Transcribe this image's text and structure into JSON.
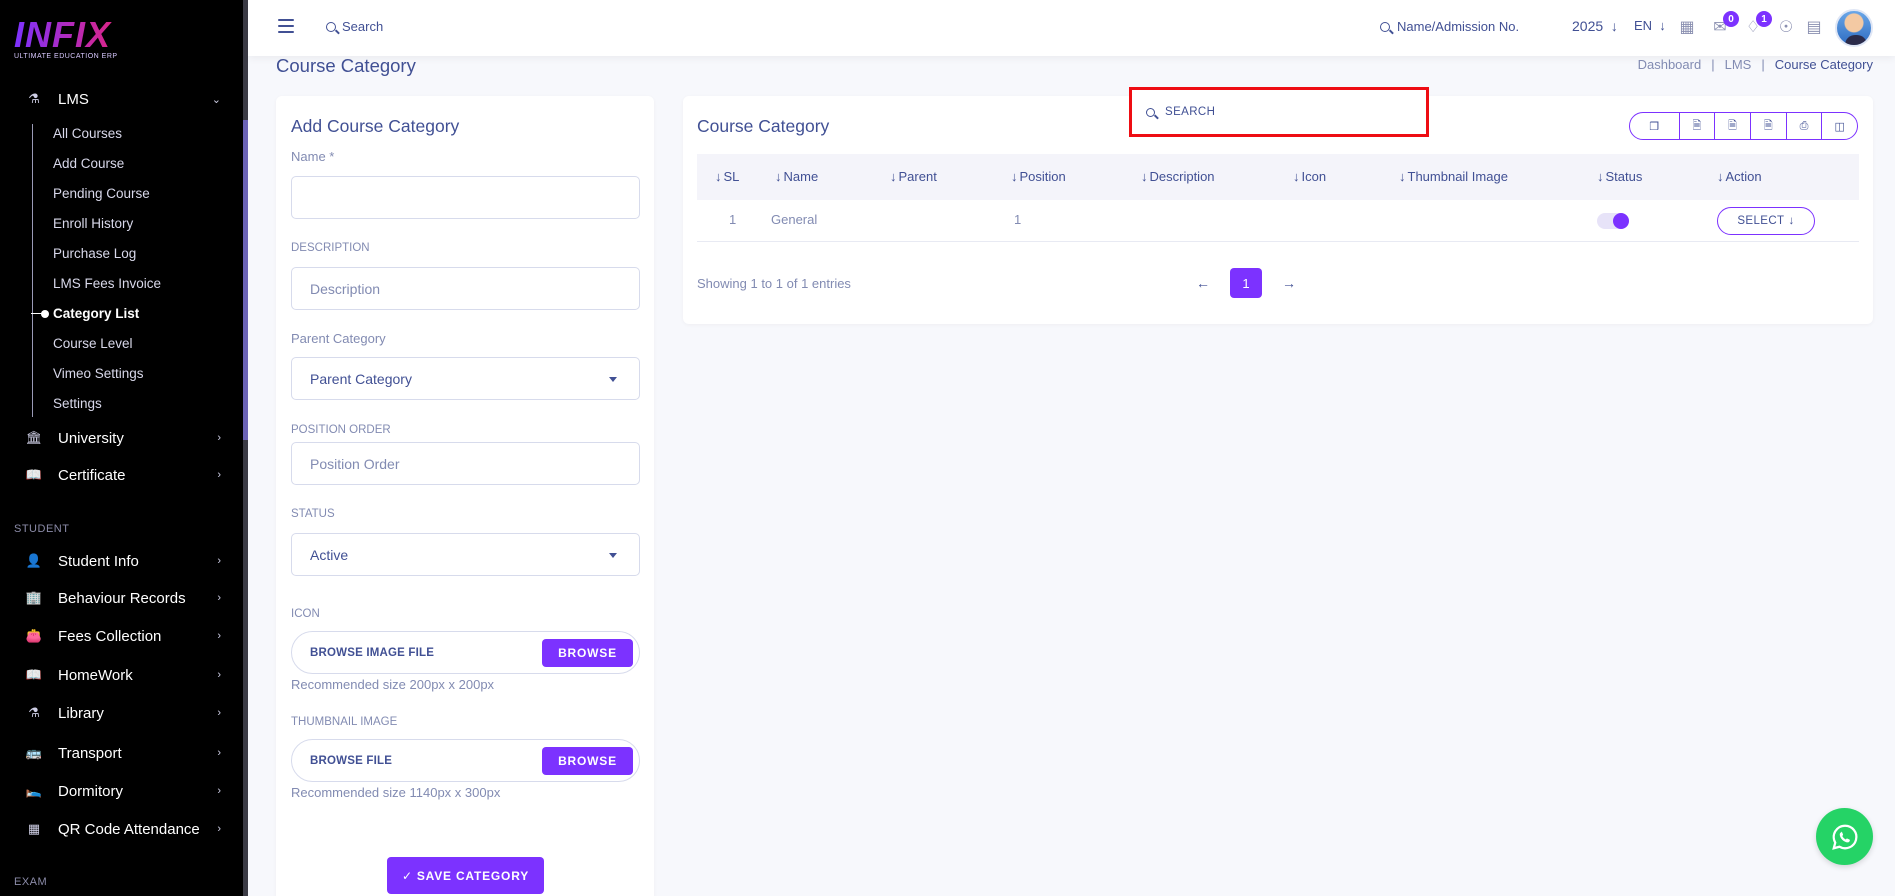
{
  "brand": {
    "name": "INFIX",
    "tagline": "ULTIMATE EDUCATION ERP"
  },
  "sidebar": {
    "lms": {
      "label": "LMS",
      "icon": "flask-icon"
    },
    "lms_items": [
      "All Courses",
      "Add Course",
      "Pending Course",
      "Enroll History",
      "Purchase Log",
      "LMS Fees Invoice",
      "Category List",
      "Course Level",
      "Vimeo Settings",
      "Settings"
    ],
    "active_item": "Category List",
    "university": {
      "label": "University",
      "icon": "bank-icon"
    },
    "certificate": {
      "label": "Certificate",
      "icon": "book-icon"
    },
    "student_section": "STUDENT",
    "student_items": [
      {
        "label": "Student Info",
        "icon": "user-icon"
      },
      {
        "label": "Behaviour Records",
        "icon": "building-icon"
      },
      {
        "label": "Fees Collection",
        "icon": "wallet-icon"
      },
      {
        "label": "HomeWork",
        "icon": "book-icon"
      },
      {
        "label": "Library",
        "icon": "flask-icon"
      },
      {
        "label": "Transport",
        "icon": "bus-icon"
      },
      {
        "label": "Dormitory",
        "icon": "bed-icon"
      },
      {
        "label": "QR Code Attendance",
        "icon": "qrcode-icon"
      }
    ],
    "exam_section": "EXAM"
  },
  "topbar": {
    "search_label": "Search",
    "admission_search": "Name/Admission No.",
    "year": "2025",
    "language": "EN",
    "messages_count": "0",
    "notifications_count": "1"
  },
  "page": {
    "title": "Course Category",
    "breadcrumb": [
      "Dashboard",
      "LMS",
      "Course Category"
    ]
  },
  "form": {
    "title": "Add Course Category",
    "name_label": "Name *",
    "name_value": "",
    "description_label": "DESCRIPTION",
    "description_placeholder": "Description",
    "parent_label": "Parent Category",
    "parent_selected": "Parent Category",
    "position_label": "POSITION ORDER",
    "position_placeholder": "Position Order",
    "status_label": "STATUS",
    "status_selected": "Active",
    "icon_label": "ICON",
    "icon_file_text": "BROWSE IMAGE FILE",
    "browse_label": "BROWSE",
    "icon_hint": "Recommended size 200px x 200px",
    "thumb_label": "THUMBNAIL IMAGE",
    "thumb_file_text": "BROWSE FILE",
    "thumb_hint": "Recommended size 1140px x 300px",
    "save_label": "SAVE CATEGORY"
  },
  "list": {
    "title": "Course Category",
    "search_placeholder": "SEARCH",
    "export_buttons": [
      "copy-icon",
      "csv-icon",
      "excel-icon",
      "pdf-icon",
      "print-icon",
      "columns-icon"
    ],
    "columns": [
      "SL",
      "Name",
      "Parent",
      "Position",
      "Description",
      "Icon",
      "Thumbnail Image",
      "Status",
      "Action"
    ],
    "rows": [
      {
        "sl": "1",
        "name": "General",
        "parent": "",
        "position": "1",
        "description": "",
        "icon": "",
        "thumbnail": "",
        "status": true,
        "action": "SELECT"
      }
    ],
    "entries_info": "Showing 1 to 1 of 1 entries",
    "current_page": "1"
  },
  "colors": {
    "accent": "#7c32ff",
    "text": "#415094",
    "muted": "#828bb2",
    "highlight": "#ee0d13",
    "whatsapp": "#25d366"
  }
}
